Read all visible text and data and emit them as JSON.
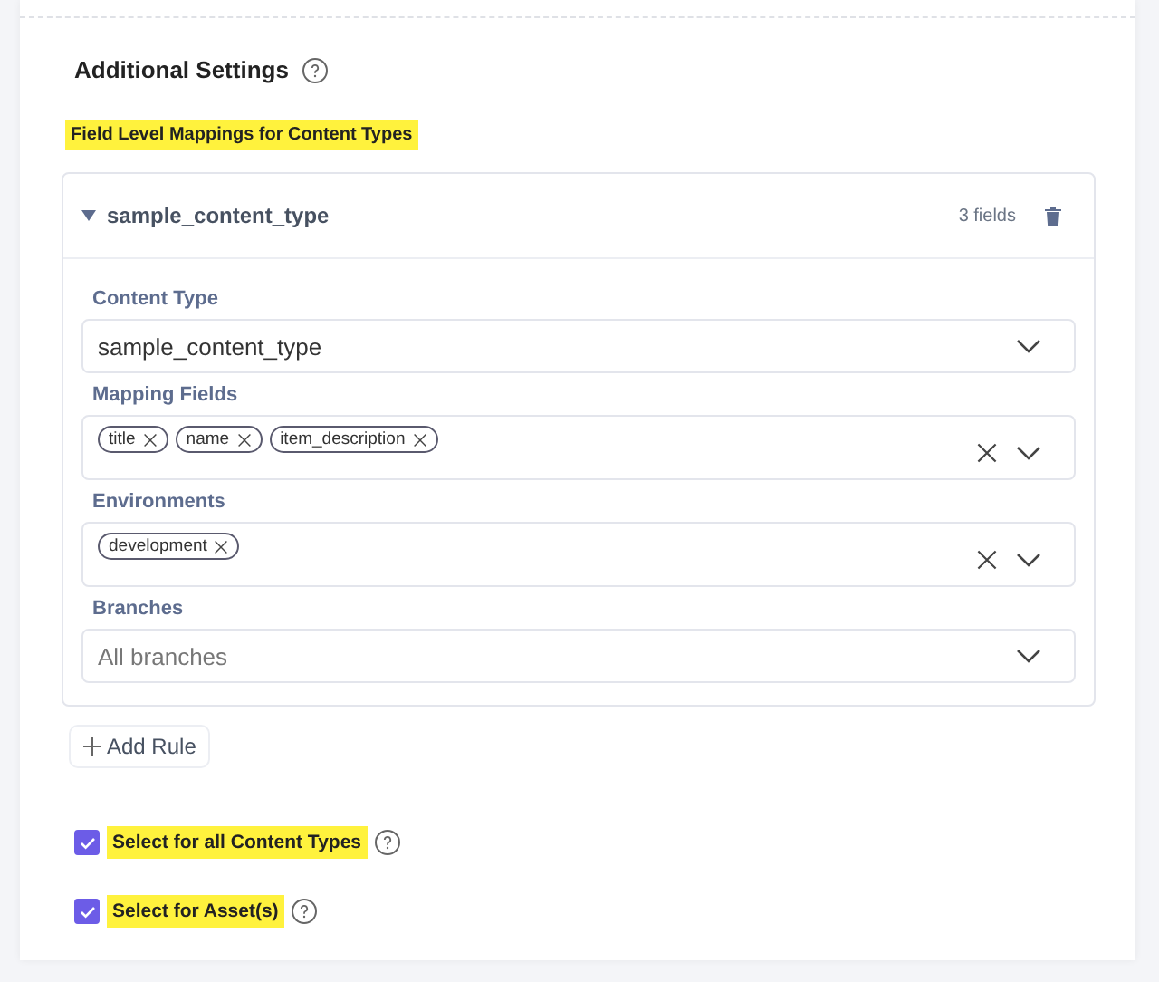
{
  "section": {
    "title": "Additional Settings",
    "subtitle": "Field Level Mappings for Content Types"
  },
  "rule": {
    "name": "sample_content_type",
    "expanded": true,
    "count": "3 fields",
    "fields": [
      {
        "kind": "select",
        "label": "Content Type",
        "value": "sample_content_type"
      },
      {
        "kind": "multi",
        "label": "Mapping Fields",
        "tags": [
          "title",
          "name",
          "item_description"
        ]
      },
      {
        "kind": "multi",
        "label": "Environments",
        "tags": [
          "development"
        ]
      },
      {
        "kind": "select",
        "label": "Branches",
        "placeholder": "All branches"
      }
    ]
  },
  "add_button": {
    "label": "Add Rule"
  },
  "options": [
    {
      "label": "Select for all Content Types",
      "checked": true
    },
    {
      "label": "Select for Asset(s)",
      "checked": true
    }
  ]
}
